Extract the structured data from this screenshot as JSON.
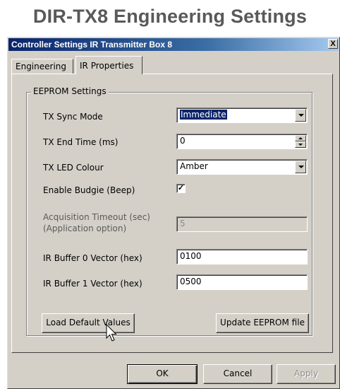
{
  "page": {
    "heading": "DIR-TX8 Engineering Settings"
  },
  "window": {
    "title": "Controller Settings IR Transmitter Box 8",
    "close_label": "X"
  },
  "tabs": [
    {
      "label": "Engineering",
      "active": false
    },
    {
      "label": "IR Properties",
      "active": true
    }
  ],
  "eeprom": {
    "group_label": "EEPROM Settings",
    "tx_sync_mode": {
      "label": "TX Sync Mode",
      "value": "Immediate"
    },
    "tx_end_time": {
      "label": "TX End Time (ms)",
      "value": "0"
    },
    "tx_led_colour": {
      "label": "TX LED Colour",
      "value": "Amber"
    },
    "enable_budgie": {
      "label": "Enable Budgie (Beep)",
      "checked": true,
      "mark": "✓"
    },
    "acquisition_timeout": {
      "label_line1": "Acquisition Timeout (sec)",
      "label_line2": "(Application option)",
      "value": "5",
      "enabled": false
    },
    "ir_buffer_0": {
      "label": "IR Buffer 0 Vector (hex)",
      "value": "0100"
    },
    "ir_buffer_1": {
      "label": "IR Buffer 1 Vector (hex)",
      "value": "0500"
    }
  },
  "buttons": {
    "load_defaults": "Load Default Values",
    "update_eeprom": "Update EEPROM file",
    "ok": "OK",
    "cancel": "Cancel",
    "apply": "Apply"
  },
  "colors": {
    "dialog_face": "#d4d0c8",
    "titlebar_start": "#0a246a",
    "titlebar_end": "#a6caf0",
    "heading_text": "#595959",
    "selection": "#0a246a"
  },
  "icons": {
    "cursor": "mouse-pointer-icon",
    "dropdown": "chevron-down-icon"
  }
}
